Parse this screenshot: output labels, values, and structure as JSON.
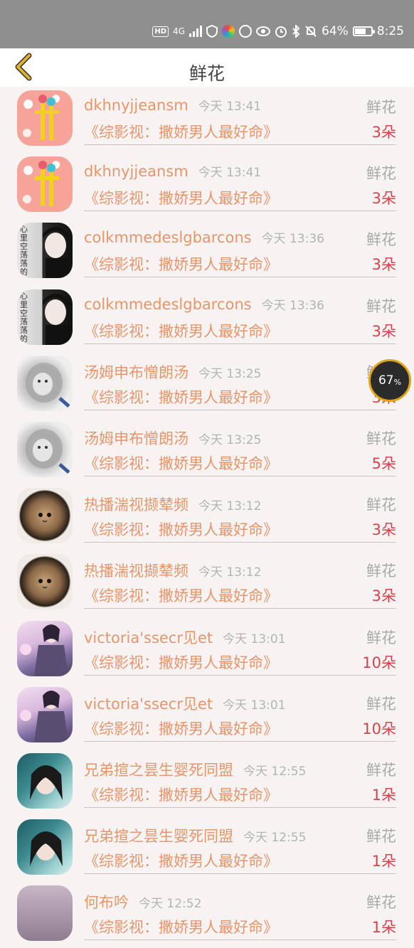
{
  "status": {
    "hd": "HD",
    "network": "4G",
    "battery": "64%",
    "battery_level": 0.64,
    "time": "8:25"
  },
  "header": {
    "title": "鲜花"
  },
  "items": [
    {
      "name": "dkhnyjjeansm",
      "time": "今天 13:41",
      "label": "鲜花",
      "book": "《综影视：撒娇男人最好命》",
      "qty": "3朵",
      "avatar": "pink"
    },
    {
      "name": "dkhnyjjeansm",
      "time": "今天 13:41",
      "label": "鲜花",
      "book": "《综影视：撒娇男人最好命》",
      "qty": "3朵",
      "avatar": "pink"
    },
    {
      "name": "colkmmedeslgbarcons",
      "time": "今天 13:36",
      "label": "鲜花",
      "book": "《综影视：撒娇男人最好命》",
      "qty": "3朵",
      "avatar": "boy",
      "avatar_text": "心里空荡荡的"
    },
    {
      "name": "colkmmedeslgbarcons",
      "time": "今天 13:36",
      "label": "鲜花",
      "book": "《综影视：撒娇男人最好命》",
      "qty": "3朵",
      "avatar": "boy",
      "avatar_text": "心里空荡荡的"
    },
    {
      "name": "汤姆申布憎朗汤",
      "time": "今天 13:25",
      "label": "鲜花",
      "book": "《综影视：撒娇男人最好命》",
      "qty": "3朵",
      "avatar": "lion"
    },
    {
      "name": "汤姆申布憎朗汤",
      "time": "今天 13:25",
      "label": "鲜花",
      "book": "《综影视：撒娇男人最好命》",
      "qty": "5朵",
      "avatar": "lion"
    },
    {
      "name": "热播湍视撷辇频",
      "time": "今天 13:12",
      "label": "鲜花",
      "book": "《综影视：撒娇男人最好命》",
      "qty": "3朵",
      "avatar": "cat"
    },
    {
      "name": "热播湍视撷辇频",
      "time": "今天 13:12",
      "label": "鲜花",
      "book": "《综影视：撒娇男人最好命》",
      "qty": "3朵",
      "avatar": "cat"
    },
    {
      "name": "victoria'ssecr见et",
      "time": "今天 13:01",
      "label": "鲜花",
      "book": "《综影视：撒娇男人最好命》",
      "qty": "10朵",
      "avatar": "anime"
    },
    {
      "name": "victoria'ssecr见et",
      "time": "今天 13:01",
      "label": "鲜花",
      "book": "《综影视：撒娇男人最好命》",
      "qty": "10朵",
      "avatar": "anime"
    },
    {
      "name": "兄弟揎之昙生婴死同盟",
      "time": "今天 12:55",
      "label": "鲜花",
      "book": "《综影视：撒娇男人最好命》",
      "qty": "1朵",
      "avatar": "girl"
    },
    {
      "name": "兄弟揎之昙生婴死同盟",
      "time": "今天 12:55",
      "label": "鲜花",
      "book": "《综影视：撒娇男人最好命》",
      "qty": "1朵",
      "avatar": "girl"
    },
    {
      "name": "何布吟",
      "time": "今天 12:52",
      "label": "鲜花",
      "book": "《综影视：撒娇男人最好命》",
      "qty": "1朵",
      "avatar": "purple"
    }
  ],
  "overlay": {
    "speed_value": "67",
    "speed_unit": "%"
  },
  "colors": {
    "accent_name": "#e8956a",
    "quantity": "#d8434b",
    "back_arrow": "#e2b22c",
    "status_bar": "#8f8f8f"
  }
}
